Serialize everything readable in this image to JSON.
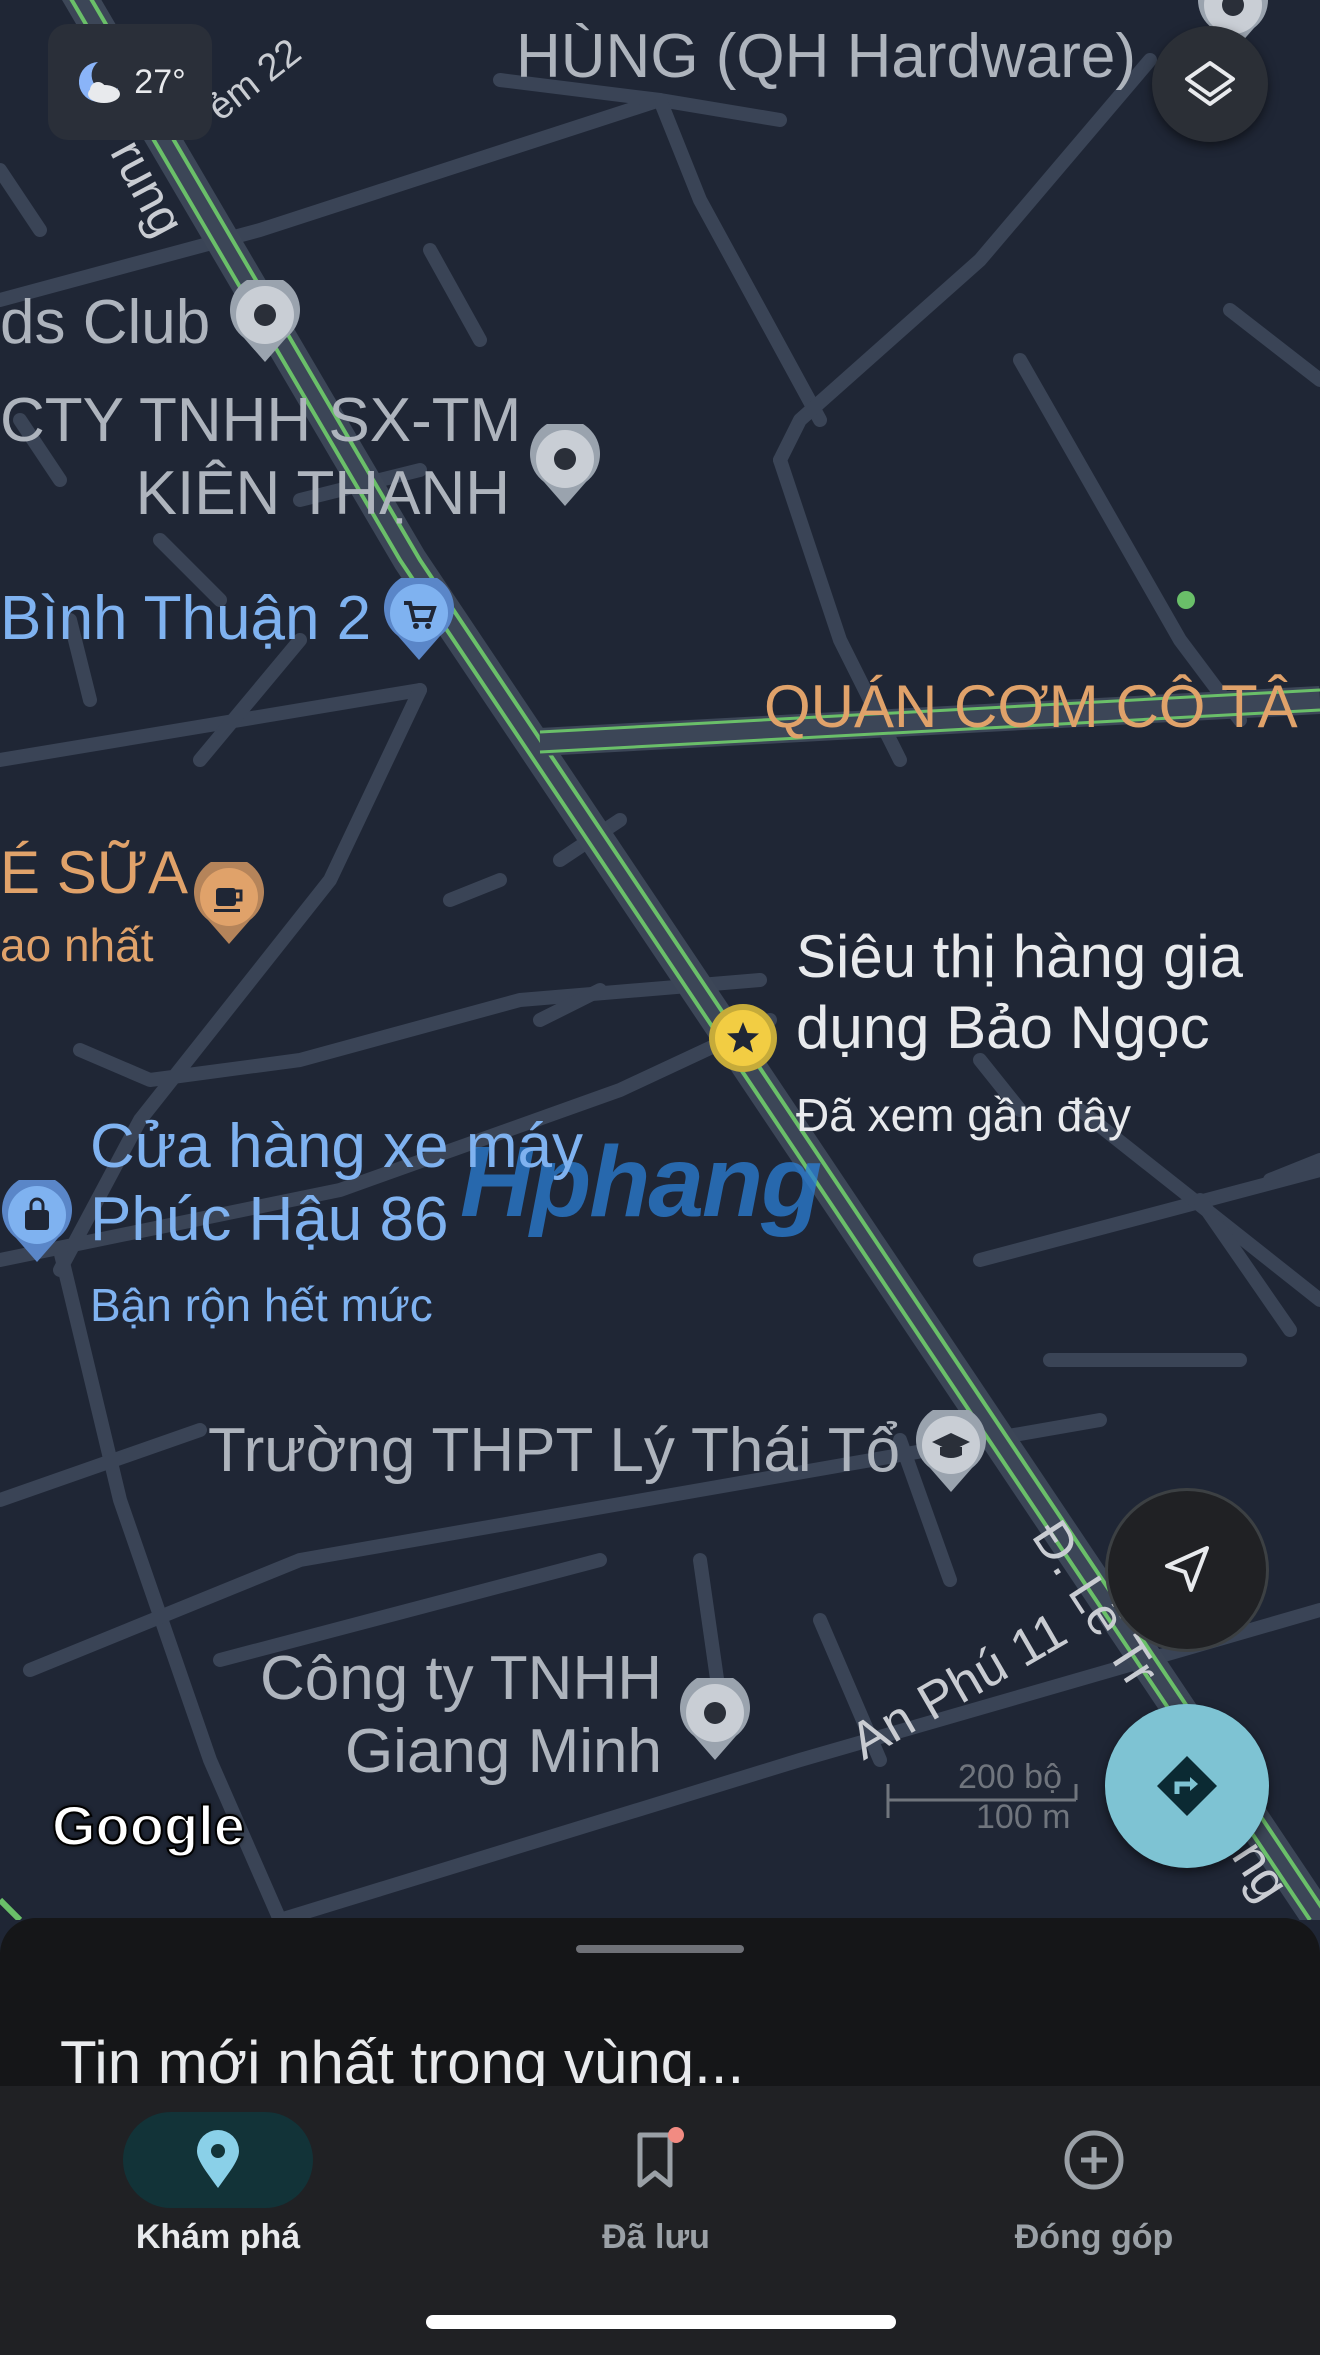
{
  "weather": {
    "temperature": "27°",
    "icon": "moon-cloud-icon"
  },
  "map": {
    "places": [
      {
        "id": "qh-hardware",
        "text": "HÙNG (QH Hardware)"
      },
      {
        "id": "club",
        "text": "ds Club"
      },
      {
        "id": "kien-thanh",
        "text": "CTY TNHH SX-TM\nKIÊN THẠNH"
      },
      {
        "id": "binh-thuan",
        "text": "Bình Thuận 2"
      },
      {
        "id": "quan-com",
        "text": "QUÁN CƠM CÔ TÂ"
      },
      {
        "id": "cafe-sua",
        "text": "É SỮA"
      },
      {
        "id": "cafe-sub",
        "text": "ao nhất"
      },
      {
        "id": "sieu-thi",
        "text": "Siêu thị hàng gia\ndụng Bảo Ngọc"
      },
      {
        "id": "sieu-thi-sub",
        "text": "Đã xem gần đây"
      },
      {
        "id": "cua-hang",
        "text": "Cửa hàng xe máy\nPhúc Hậu 86"
      },
      {
        "id": "cua-hang-sub",
        "text": "Bận rộn hết mức"
      },
      {
        "id": "truong",
        "text": "Trường THPT Lý Thái Tổ"
      },
      {
        "id": "cong-ty",
        "text": "Công ty TNHH\nGiang Minh"
      }
    ],
    "roads": {
      "hem22": "ẻm 22",
      "top_left": "rung",
      "an_phu": "An Phú 11",
      "le_trung": "Đ. Lê Tr",
      "le_trung_end": "ng"
    },
    "watermark": "Hphang",
    "logo": "Google",
    "scale": {
      "imperial": "200 bộ",
      "metric": "100 m"
    }
  },
  "sheet": {
    "title": "Tin mới nhất trong vùng..."
  },
  "nav": {
    "tabs": [
      {
        "label": "Khám phá",
        "icon": "location-pin-icon",
        "active": true
      },
      {
        "label": "Đã lưu",
        "icon": "bookmark-icon",
        "active": false
      },
      {
        "label": "Đóng góp",
        "icon": "add-circle-icon",
        "active": false
      }
    ]
  },
  "colors": {
    "map_bg": "#1f2635",
    "road": "#3c4657",
    "traffic": "#6abf69",
    "accent": "#7ec3d3",
    "active_tab": "#8ab4f8"
  }
}
